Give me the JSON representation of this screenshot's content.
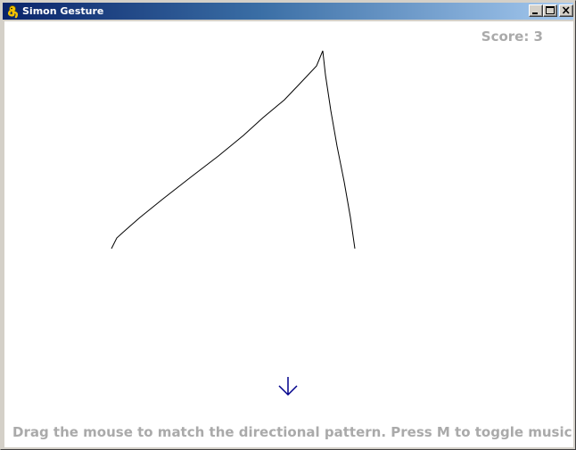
{
  "window": {
    "title": "Simon Gesture",
    "icon": "pygame-snake-icon"
  },
  "game": {
    "score_text": "Score: 3",
    "current_direction": "down",
    "direction_icon": "arrow-down-icon",
    "instructions": "Drag the mouse to match the directional pattern. Press M to toggle music.",
    "text_color": "#aaaaaa",
    "arrow_color": "#00008b",
    "trail_color": "#000000"
  }
}
